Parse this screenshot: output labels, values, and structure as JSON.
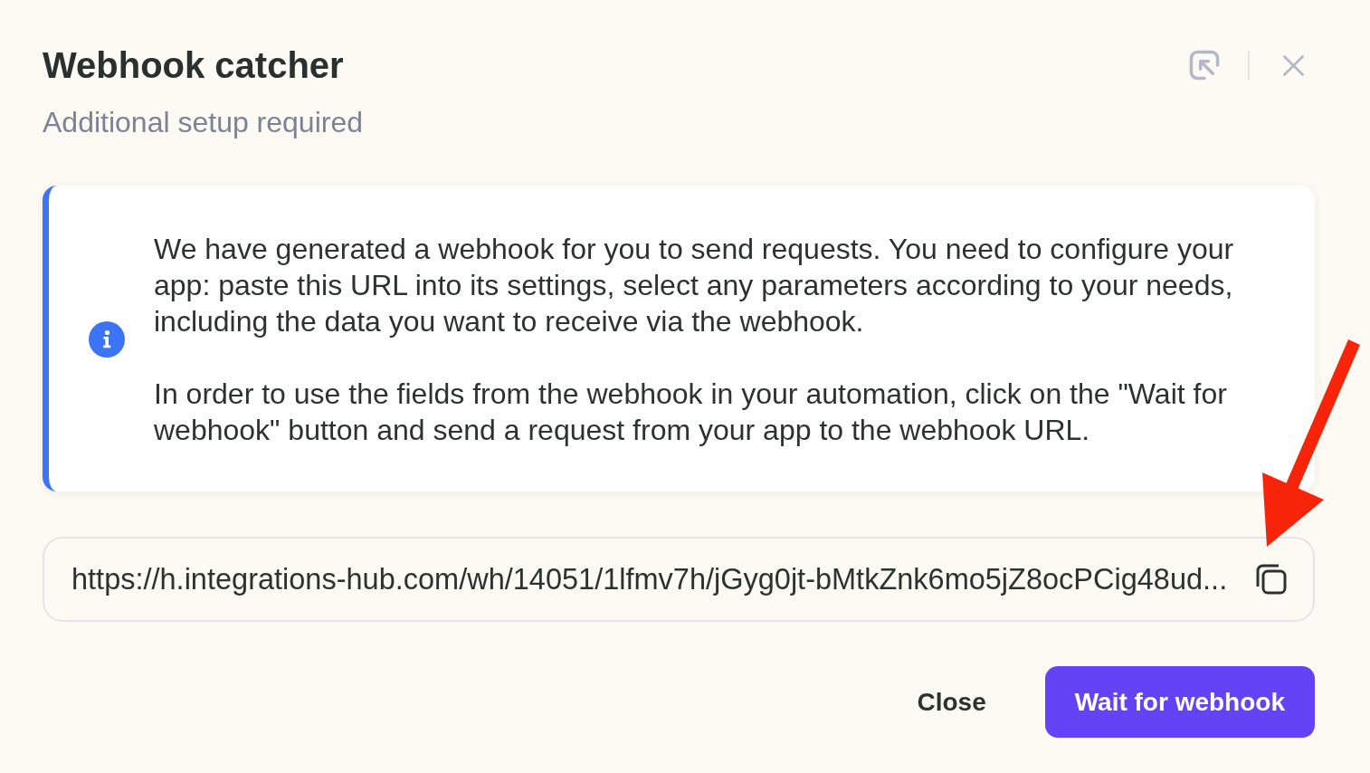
{
  "dialog": {
    "title": "Webhook catcher",
    "subtitle": "Additional setup required"
  },
  "info_callout": {
    "paragraphs": [
      "We have generated a webhook for you to send requests. You need to configure your app: paste this URL into its settings, select any parameters according to your needs, including the data you want to receive via the webhook.",
      "In order to use the fields from the webhook in your automation, click on the \"Wait for webhook\" button and send a request from your app to the webhook URL."
    ]
  },
  "webhook_url": {
    "value": "https://h.integrations-hub.com/wh/14051/1lfmv7h/jGyg0jt-bMtkZnk6mo5jZ8ocPCig48ud..."
  },
  "buttons": [
    {
      "label": "Close",
      "kind": "secondary"
    },
    {
      "label": "Wait for webhook",
      "kind": "primary"
    }
  ]
}
